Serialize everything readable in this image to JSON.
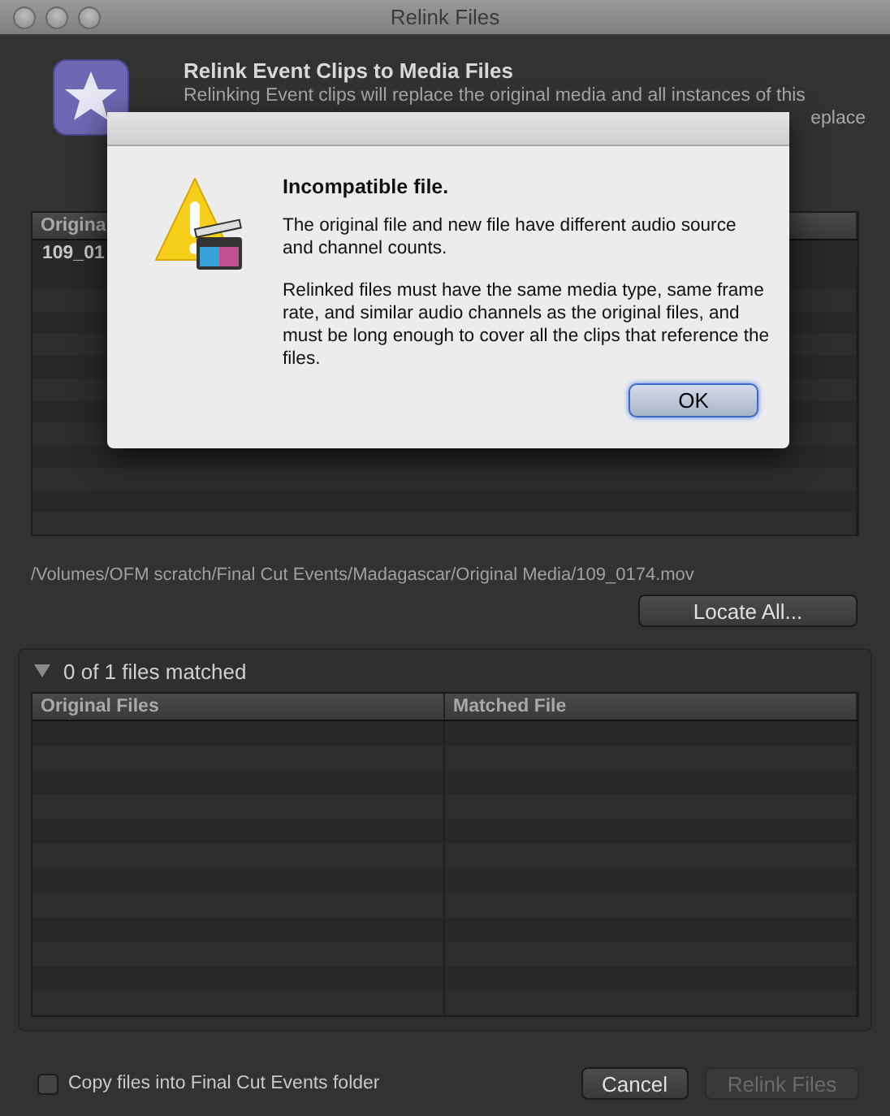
{
  "window": {
    "title": "Relink Files"
  },
  "header": {
    "title": "Relink Event Clips to Media Files",
    "description_line_1": "Relinking Event clips will replace the original media and all instances of this",
    "description_line_2": "eplace"
  },
  "missing_table": {
    "columns": [
      "Origina"
    ],
    "rows": [
      [
        "109_01"
      ]
    ]
  },
  "path": "/Volumes/OFM scratch/Final Cut Events/Madagascar/Original Media/109_0174.mov",
  "locate_button": "Locate All...",
  "matched": {
    "expanded": true,
    "label": "0 of 1 files matched",
    "columns": [
      "Original Files",
      "Matched File"
    ]
  },
  "copy_checkbox": {
    "label": "Copy files into Final Cut Events folder",
    "checked": false
  },
  "buttons": [
    {
      "label": "Cancel",
      "disabled": false
    },
    {
      "label": "Relink Files",
      "disabled": true
    }
  ],
  "alert": {
    "title": "Incompatible file.",
    "messages": [
      "The original file and new file have different audio source and channel counts.",
      "Relinked files must have the same media type, same frame rate, and similar audio channels as the original files, and must be long enough to cover all the clips that reference the files."
    ],
    "button": {
      "label": "OK",
      "default": true
    }
  }
}
